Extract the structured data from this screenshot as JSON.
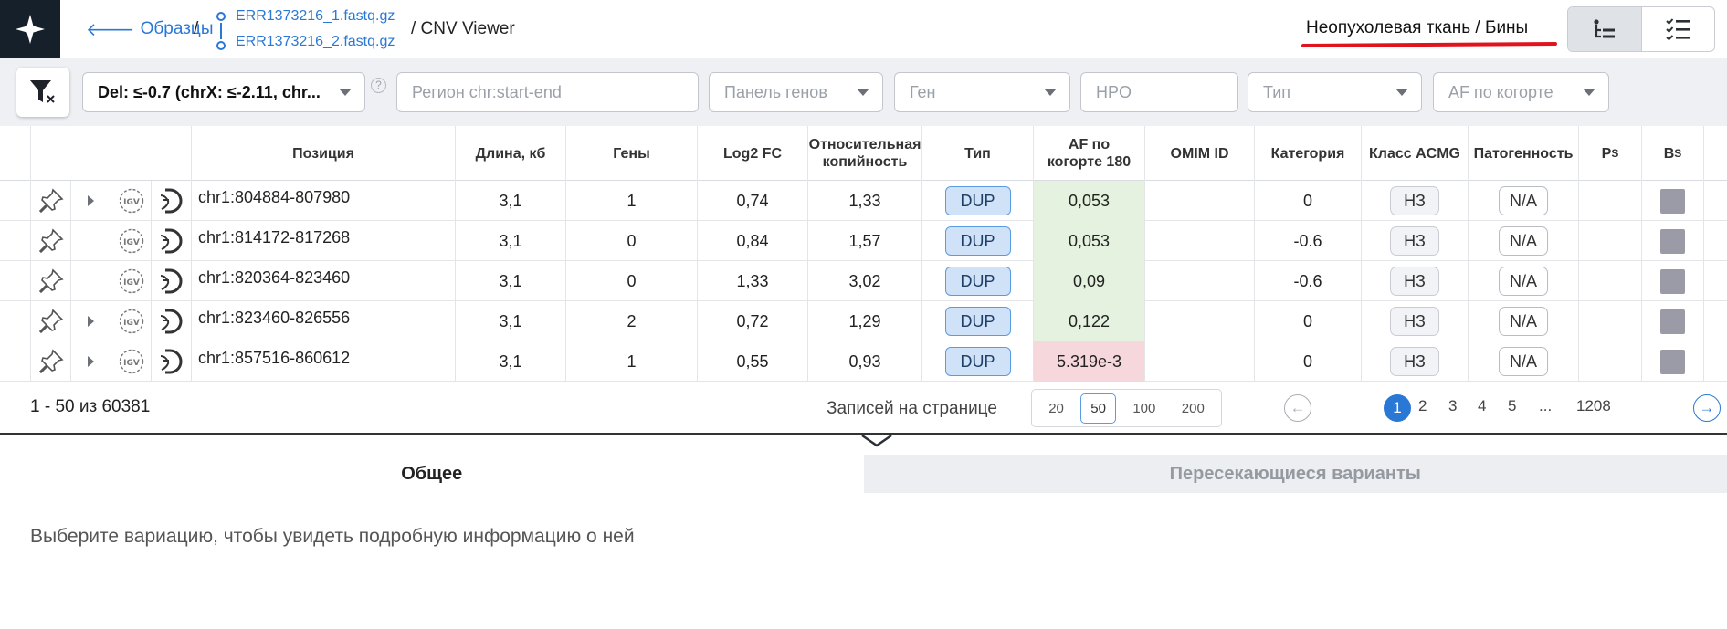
{
  "header": {
    "back_label": "Образцы",
    "sep": "/",
    "files": [
      "ERR1373216_1.fastq.gz",
      "ERR1373216_2.fastq.gz"
    ],
    "page_title": "/ CNV Viewer",
    "sample_label": "Неопухолевая ткань / Бины"
  },
  "filters": {
    "preset": "Del: ≤-0.7 (chrX: ≤-2.11, chr...",
    "help": "?",
    "region_placeholder": "Регион chr:start-end",
    "panel_placeholder": "Панель генов",
    "gene_placeholder": "Ген",
    "hpo_placeholder": "HPO",
    "type_placeholder": "Тип",
    "af_placeholder": "AF по когорте"
  },
  "table": {
    "headers": {
      "position": "Позиция",
      "length": "Длина, кб",
      "genes": "Гены",
      "log2fc": "Log2 FC",
      "relcopy": "Относительная копийность",
      "type": "Тип",
      "af": "AF по когорте 180",
      "omim": "OMIM ID",
      "category": "Категория",
      "acmg": "Класс ACMG",
      "path": "Патогенность",
      "ps": "P",
      "ps_sub": "S",
      "bs": "B",
      "bs_sub": "S"
    },
    "rows": [
      {
        "position": "chr1:804884-807980",
        "length": "3,1",
        "genes": "1",
        "log2fc": "0,74",
        "relcopy": "1,33",
        "type": "DUP",
        "af": "0,053",
        "af_status": "green",
        "omim": "",
        "category": "0",
        "acmg": "НЗ",
        "path": "N/A",
        "expandable": true
      },
      {
        "position": "chr1:814172-817268",
        "length": "3,1",
        "genes": "0",
        "log2fc": "0,84",
        "relcopy": "1,57",
        "type": "DUP",
        "af": "0,053",
        "af_status": "green",
        "omim": "",
        "category": "-0.6",
        "acmg": "НЗ",
        "path": "N/A",
        "expandable": false
      },
      {
        "position": "chr1:820364-823460",
        "length": "3,1",
        "genes": "0",
        "log2fc": "1,33",
        "relcopy": "3,02",
        "type": "DUP",
        "af": "0,09",
        "af_status": "green",
        "omim": "",
        "category": "-0.6",
        "acmg": "НЗ",
        "path": "N/A",
        "expandable": false
      },
      {
        "position": "chr1:823460-826556",
        "length": "3,1",
        "genes": "2",
        "log2fc": "0,72",
        "relcopy": "1,29",
        "type": "DUP",
        "af": "0,122",
        "af_status": "green",
        "omim": "",
        "category": "0",
        "acmg": "НЗ",
        "path": "N/A",
        "expandable": true
      },
      {
        "position": "chr1:857516-860612",
        "length": "3,1",
        "genes": "1",
        "log2fc": "0,55",
        "relcopy": "0,93",
        "type": "DUP",
        "af": "5.319e-3",
        "af_status": "red",
        "omim": "",
        "category": "0",
        "acmg": "НЗ",
        "path": "N/A",
        "expandable": true
      }
    ]
  },
  "pagination": {
    "total": "1 - 50 из 60381",
    "rpp_label": "Записей на странице",
    "rpp_options": [
      "20",
      "50",
      "100",
      "200"
    ],
    "rpp_selected": "50",
    "pages": [
      "1",
      "2",
      "3",
      "4",
      "5",
      "...",
      "1208"
    ],
    "current": "1",
    "prev": "←",
    "next": "→"
  },
  "details": {
    "tab_general": "Общее",
    "tab_overlap": "Пересекающиеся варианты",
    "hint": "Выберите вариацию, чтобы увидеть подробную информацию о ней"
  },
  "colors": {
    "accent": "#2a78d6",
    "af_green": "#e4f2df",
    "af_red": "#f6d7dc",
    "underline": "#e0141e"
  }
}
